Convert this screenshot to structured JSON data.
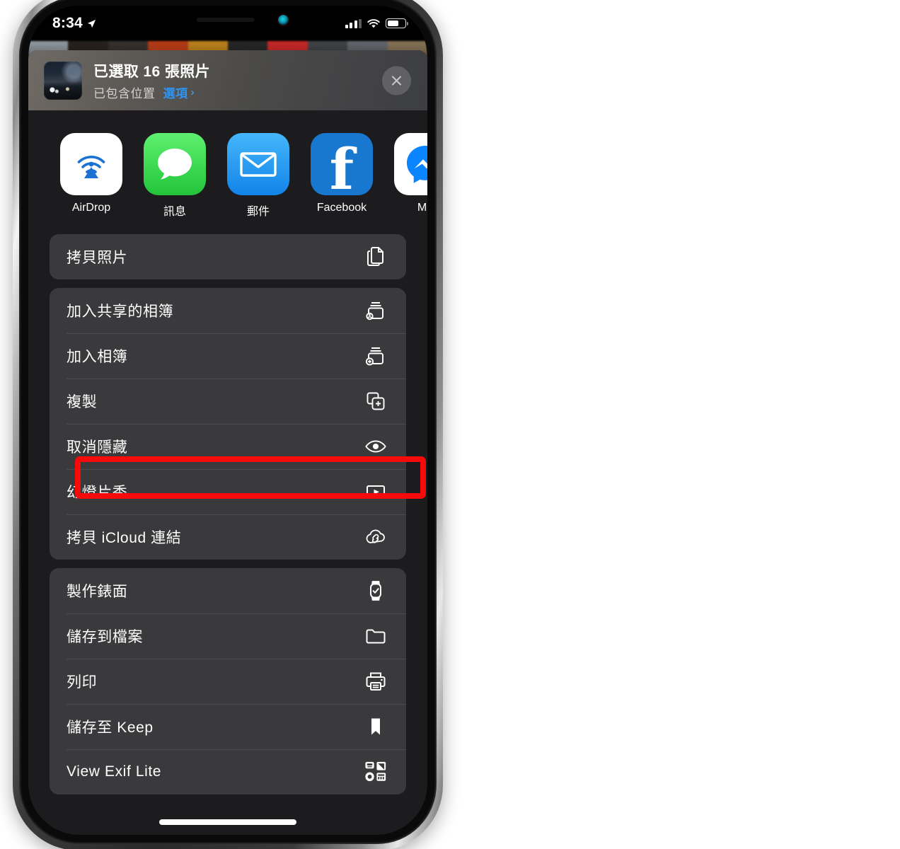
{
  "device": {
    "model": "iphone-x-style",
    "statusbar": {
      "time": "8:34",
      "location_icon": "location-arrow-icon",
      "cellular_icon": "cellular-bars-icon",
      "cellular_bars_filled": 3,
      "wifi_icon": "wifi-icon",
      "battery_icon": "battery-icon",
      "battery_level_pct": 58
    }
  },
  "sheet": {
    "header": {
      "thumbnail_name": "selected-photo-thumbnail",
      "title": "已選取 16 張照片",
      "subtitle": "已包含位置",
      "options_label": "選項",
      "options_chevron": "›",
      "close_icon": "close-icon"
    },
    "apps": [
      {
        "name": "airdrop",
        "label": "AirDrop",
        "icon": "airdrop-icon"
      },
      {
        "name": "messages",
        "label": "訊息",
        "icon": "messages-icon"
      },
      {
        "name": "mail",
        "label": "郵件",
        "icon": "mail-icon"
      },
      {
        "name": "facebook",
        "label": "Facebook",
        "icon": "facebook-icon"
      },
      {
        "name": "messenger",
        "label": "Me",
        "icon": "messenger-icon"
      }
    ],
    "groups": [
      {
        "rows": [
          {
            "label": "拷貝照片",
            "icon": "copy-photos-icon"
          }
        ]
      },
      {
        "rows": [
          {
            "label": "加入共享的相簿",
            "icon": "add-to-shared-album-icon"
          },
          {
            "label": "加入相簿",
            "icon": "add-to-album-icon"
          },
          {
            "label": "複製",
            "icon": "duplicate-icon"
          },
          {
            "label": "取消隱藏",
            "icon": "eye-icon",
            "highlighted": true
          },
          {
            "label": "幻燈片秀",
            "icon": "play-slideshow-icon"
          },
          {
            "label": "拷貝 iCloud 連結",
            "icon": "icloud-link-icon"
          }
        ]
      },
      {
        "rows": [
          {
            "label": "製作錶面",
            "icon": "watch-face-icon"
          },
          {
            "label": "儲存到檔案",
            "icon": "folder-icon"
          },
          {
            "label": "列印",
            "icon": "printer-icon"
          },
          {
            "label": "儲存至 Keep",
            "icon": "bookmark-icon"
          },
          {
            "label": "View Exif Lite",
            "icon": "exif-grid-icon"
          }
        ]
      }
    ],
    "home_indicator": "home-indicator"
  },
  "annotation": {
    "highlight_color": "#f60a0a",
    "highlight_target": "取消隱藏"
  },
  "colors": {
    "sheet_bg": "#1c1c1e",
    "card_bg": "#3a3a3c",
    "accent_blue": "#2f93f0",
    "text_primary": "#ffffff",
    "text_secondary": "#d2d2d4"
  }
}
